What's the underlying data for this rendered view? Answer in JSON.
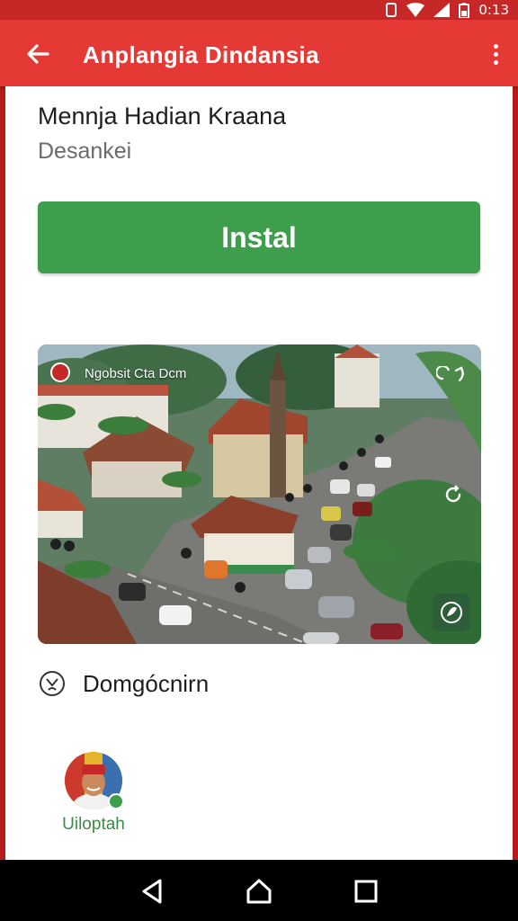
{
  "status_bar": {
    "time": "0:13"
  },
  "app_bar": {
    "title": "Anplangia Dindansia"
  },
  "app": {
    "name": "Mennja Hadian Kraana",
    "developer": "Desankei",
    "install_label": "Instal"
  },
  "screenshot": {
    "caption": "Ngobsit Cta Dcm"
  },
  "category": {
    "label": "Domgócnirn"
  },
  "uploader": {
    "name": "Uiloptah"
  },
  "colors": {
    "status_bar": "#c62828",
    "app_bar": "#e53935",
    "install_button": "#3d9e4c",
    "uploader_name": "#3d8a47"
  },
  "icons": [
    "arrow-back-icon",
    "more-vert-icon",
    "wifi-icon",
    "signal-icon",
    "battery-icon",
    "category-icon",
    "share-icon",
    "refresh-icon",
    "badge-icon",
    "nav-back-icon",
    "nav-home-icon",
    "nav-recents-icon"
  ]
}
